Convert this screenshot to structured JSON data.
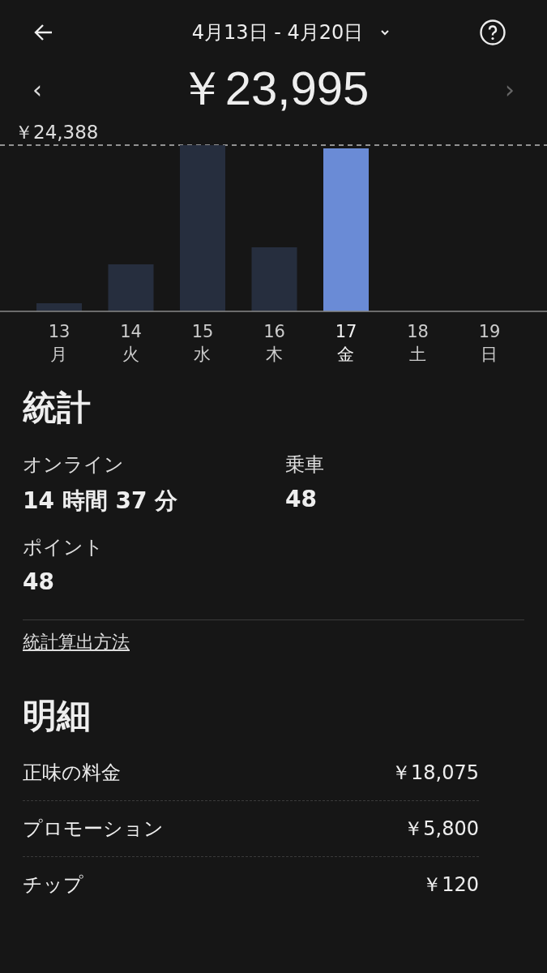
{
  "header": {
    "date_range": "4月13日 - 4月20日"
  },
  "total": {
    "amount": "￥23,995",
    "prev": "‹",
    "next": "›"
  },
  "chart": {
    "max_label": "￥24,388",
    "days": [
      {
        "day": "13",
        "weekday": "月",
        "selected": false
      },
      {
        "day": "14",
        "weekday": "火",
        "selected": false
      },
      {
        "day": "15",
        "weekday": "水",
        "selected": false
      },
      {
        "day": "16",
        "weekday": "木",
        "selected": false
      },
      {
        "day": "17",
        "weekday": "金",
        "selected": true
      },
      {
        "day": "18",
        "weekday": "土",
        "selected": false
      },
      {
        "day": "19",
        "weekday": "日",
        "selected": false
      }
    ]
  },
  "stats": {
    "title": "統計",
    "items": [
      {
        "label": "オンライン",
        "value": "14 時間 37 分"
      },
      {
        "label": "乗車",
        "value": "48"
      },
      {
        "label": "ポイント",
        "value": "48"
      }
    ],
    "link": "統計算出方法"
  },
  "breakdown": {
    "title": "明細",
    "rows": [
      {
        "label": "正味の料金",
        "amount": "￥18,075"
      },
      {
        "label": "プロモーション",
        "amount": "￥5,800"
      },
      {
        "label": "チップ",
        "amount": "￥120"
      }
    ]
  }
}
